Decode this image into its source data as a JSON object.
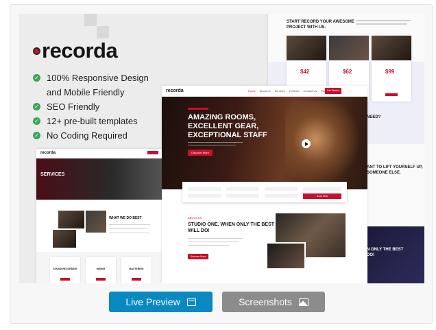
{
  "brand": {
    "name": "recorda"
  },
  "features": [
    {
      "label": "100% Responsive Design"
    },
    {
      "label": "and Mobile Friendly"
    },
    {
      "label": "SEO Friendly"
    },
    {
      "label": "12+ pre-built templates"
    },
    {
      "label": "No Coding Required"
    }
  ],
  "mock_home": {
    "logo": "recorda",
    "nav": [
      "Home",
      "About us",
      "Services",
      "Portfolio",
      "Contact Us",
      "Pages"
    ],
    "cta": "Get Started",
    "hero_title_1": "AMAZING ROOMS,",
    "hero_title_2": "EXCELLENT GEAR,",
    "hero_title_3": "EXCEPTIONAL STAFF",
    "hero_button": "Discover More",
    "book_button": "Book Now",
    "studio_label": "ABOUT US",
    "studio_title_1": "STUDIO ONE. WHEN ONLY THE BEST",
    "studio_title_2": "WILL DO!",
    "studio_button": "Discover More"
  },
  "mock_services": {
    "logo": "recorda",
    "banner_title": "SERVICES",
    "section_title": "WHAT WE DO BEST",
    "cards": [
      "SOUND RECORDING",
      "MIXING",
      "MASTERING"
    ]
  },
  "mock_pricing": {
    "title_1": "START RECORD YOUR AWESOME",
    "title_2": "PROJECT WITH US.",
    "prices": [
      "42",
      "62",
      "99"
    ],
    "side_q": "NEED?",
    "side_t1": "ANT TO LIFT YOURSELF UP,",
    "side_t2": "SOMEONE ELSE.",
    "side_dark_1": "N ONLY THE BEST",
    "side_dark_2": "DO!"
  },
  "actions": {
    "live_preview": "Live Preview",
    "screenshots": "Screenshots"
  }
}
